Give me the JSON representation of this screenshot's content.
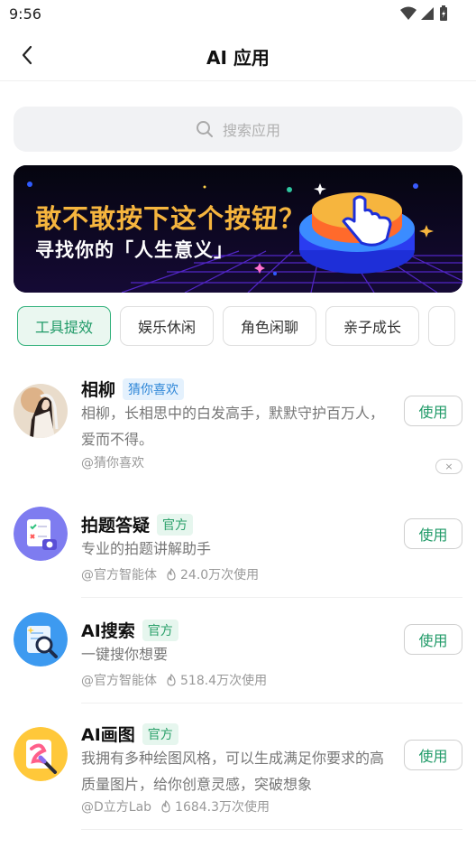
{
  "status": {
    "time": "9:56"
  },
  "nav": {
    "title": "AI 应用"
  },
  "search": {
    "placeholder": "搜索应用"
  },
  "banner": {
    "line1": "敢不敢按下这个按钮？",
    "line2": "寻找你的「人生意义」"
  },
  "tabs": [
    {
      "label": "工具提效",
      "active": true
    },
    {
      "label": "娱乐休闲",
      "active": false
    },
    {
      "label": "角色闲聊",
      "active": false
    },
    {
      "label": "亲子成长",
      "active": false
    }
  ],
  "items": [
    {
      "title": "相柳",
      "badge": "猜你喜欢",
      "desc": "相柳，长相思中的白发高手，默默守护百万人，爱而不得。",
      "author": "@猜你喜欢",
      "uses": "",
      "button": "使用",
      "dismiss": "×"
    },
    {
      "title": "拍题答疑",
      "badge": "官方",
      "desc": "专业的拍题讲解助手",
      "author": "@官方智能体",
      "uses": "24.0万次使用",
      "button": "使用"
    },
    {
      "title": "AI搜索",
      "badge": "官方",
      "desc": "一键搜你想要",
      "author": "@官方智能体",
      "uses": "518.4万次使用",
      "button": "使用"
    },
    {
      "title": "AI画图",
      "badge": "官方",
      "desc": "我拥有多种绘图风格，可以生成满足你要求的高质量图片，给你创意灵感，突破想象",
      "author": "@D立方Lab",
      "uses": "1684.3万次使用",
      "button": "使用"
    }
  ],
  "colors": {
    "accent": "#1f9a67",
    "badge_blue": "#2f87d8",
    "banner_gold": "#f6b53e"
  }
}
